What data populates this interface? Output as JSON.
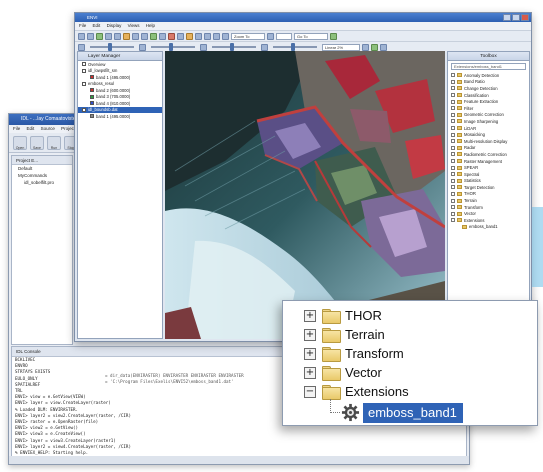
{
  "idl": {
    "title": "IDL - ...lay Comaatoviste...",
    "menu": [
      "File",
      "Edit",
      "Source",
      "Project",
      "Run",
      "Window",
      "Help"
    ],
    "toolbar": [
      "Open",
      "Save File",
      "Run",
      "Stop"
    ],
    "project_tab": "Project E...",
    "project_items": [
      "Default",
      "MyCommands",
      "idl_sobelfilt.pro"
    ],
    "console_tab": "IDL Console",
    "console_lines": [
      "BCKLIVEC",
      "ENVRO",
      "STRTAYS EXISTS",
      "EULO_ONLY",
      "SPATIALREF",
      "TRL",
      "ENVI> view = e.GetView(VIEW)",
      "ENVI> layer = view.CreateLayer(raster)",
      "% Loaded DLM: ENVIRASTER.",
      "ENVI> layer2 = view2.CreateLayer(raster, /CIR)",
      "ENVI> raster = e.OpenRaster(file)",
      "ENVI> view2 = e.GetView()",
      "ENVI> view3 = e.CreateView()",
      "ENVI> layer = view3.CreateLayer(raster1)",
      "ENVI> layer2 = view4.CreateLayer(raster, /CIR)",
      "% ENVIEX_HELP: Starting help."
    ],
    "console_overlay": [
      "= dir_data(ENVIRASTER)  ENVIRASTER ENVIRASTER ENVIRASTER",
      "= 'C:\\Program Files\\Exelis\\ENVI52\\emboss_band1.dat'"
    ]
  },
  "envi": {
    "title": "ENVI",
    "menu": [
      "File",
      "Edit",
      "Display",
      "Views",
      "Help"
    ],
    "zoom_field": "Zoom To",
    "goto_field": "Go To",
    "stretch_field": "Linear 2%",
    "layer_manager": {
      "title": "Layer Manager",
      "items": [
        {
          "label": "Overview",
          "swatch": "#ffffff"
        },
        {
          "label": "idl_lowpsfilt_sm",
          "swatch": "#ffffff"
        },
        {
          "label": "band 1 (495.0000)",
          "swatch": "#d03030"
        },
        {
          "label": "emboss_resul",
          "swatch": "#ffffff"
        },
        {
          "label": "band 2 (600.0000)",
          "swatch": "#d03030"
        },
        {
          "label": "band 3 (705.0000)",
          "swatch": "#30a040"
        },
        {
          "label": "band 4 (810.0000)",
          "swatch": "#3050d0"
        },
        {
          "label": "idl_boundsb.dat",
          "swatch": "#ffffff"
        },
        {
          "label": "band 1 (495.0000)",
          "swatch": "#888888"
        }
      ]
    },
    "toolbox": {
      "title": "Toolbox",
      "search_placeholder": "Search the toolbox",
      "search_value": "Extensions/emboss_band1",
      "items": [
        "Anomaly Detection",
        "Band Ratio",
        "Change Detection",
        "Classification",
        "Feature Extraction",
        "Filter",
        "Geometric Correction",
        "Image Sharpening",
        "LiDAR",
        "Mosaicking",
        "Multi-resolution Display",
        "Radar",
        "Radiometric Correction",
        "Raster Management",
        "SPEAR",
        "Spectral",
        "Statistics",
        "Target Detection",
        "THOR",
        "Terrain",
        "Transform",
        "Vector",
        "Extensions",
        "emboss_band1"
      ]
    }
  },
  "callout": {
    "items": [
      "THOR",
      "Terrain",
      "Transform",
      "Vector",
      "Extensions"
    ],
    "expanders": [
      "+",
      "+",
      "+",
      "+",
      "−"
    ],
    "child": "emboss_band1"
  }
}
